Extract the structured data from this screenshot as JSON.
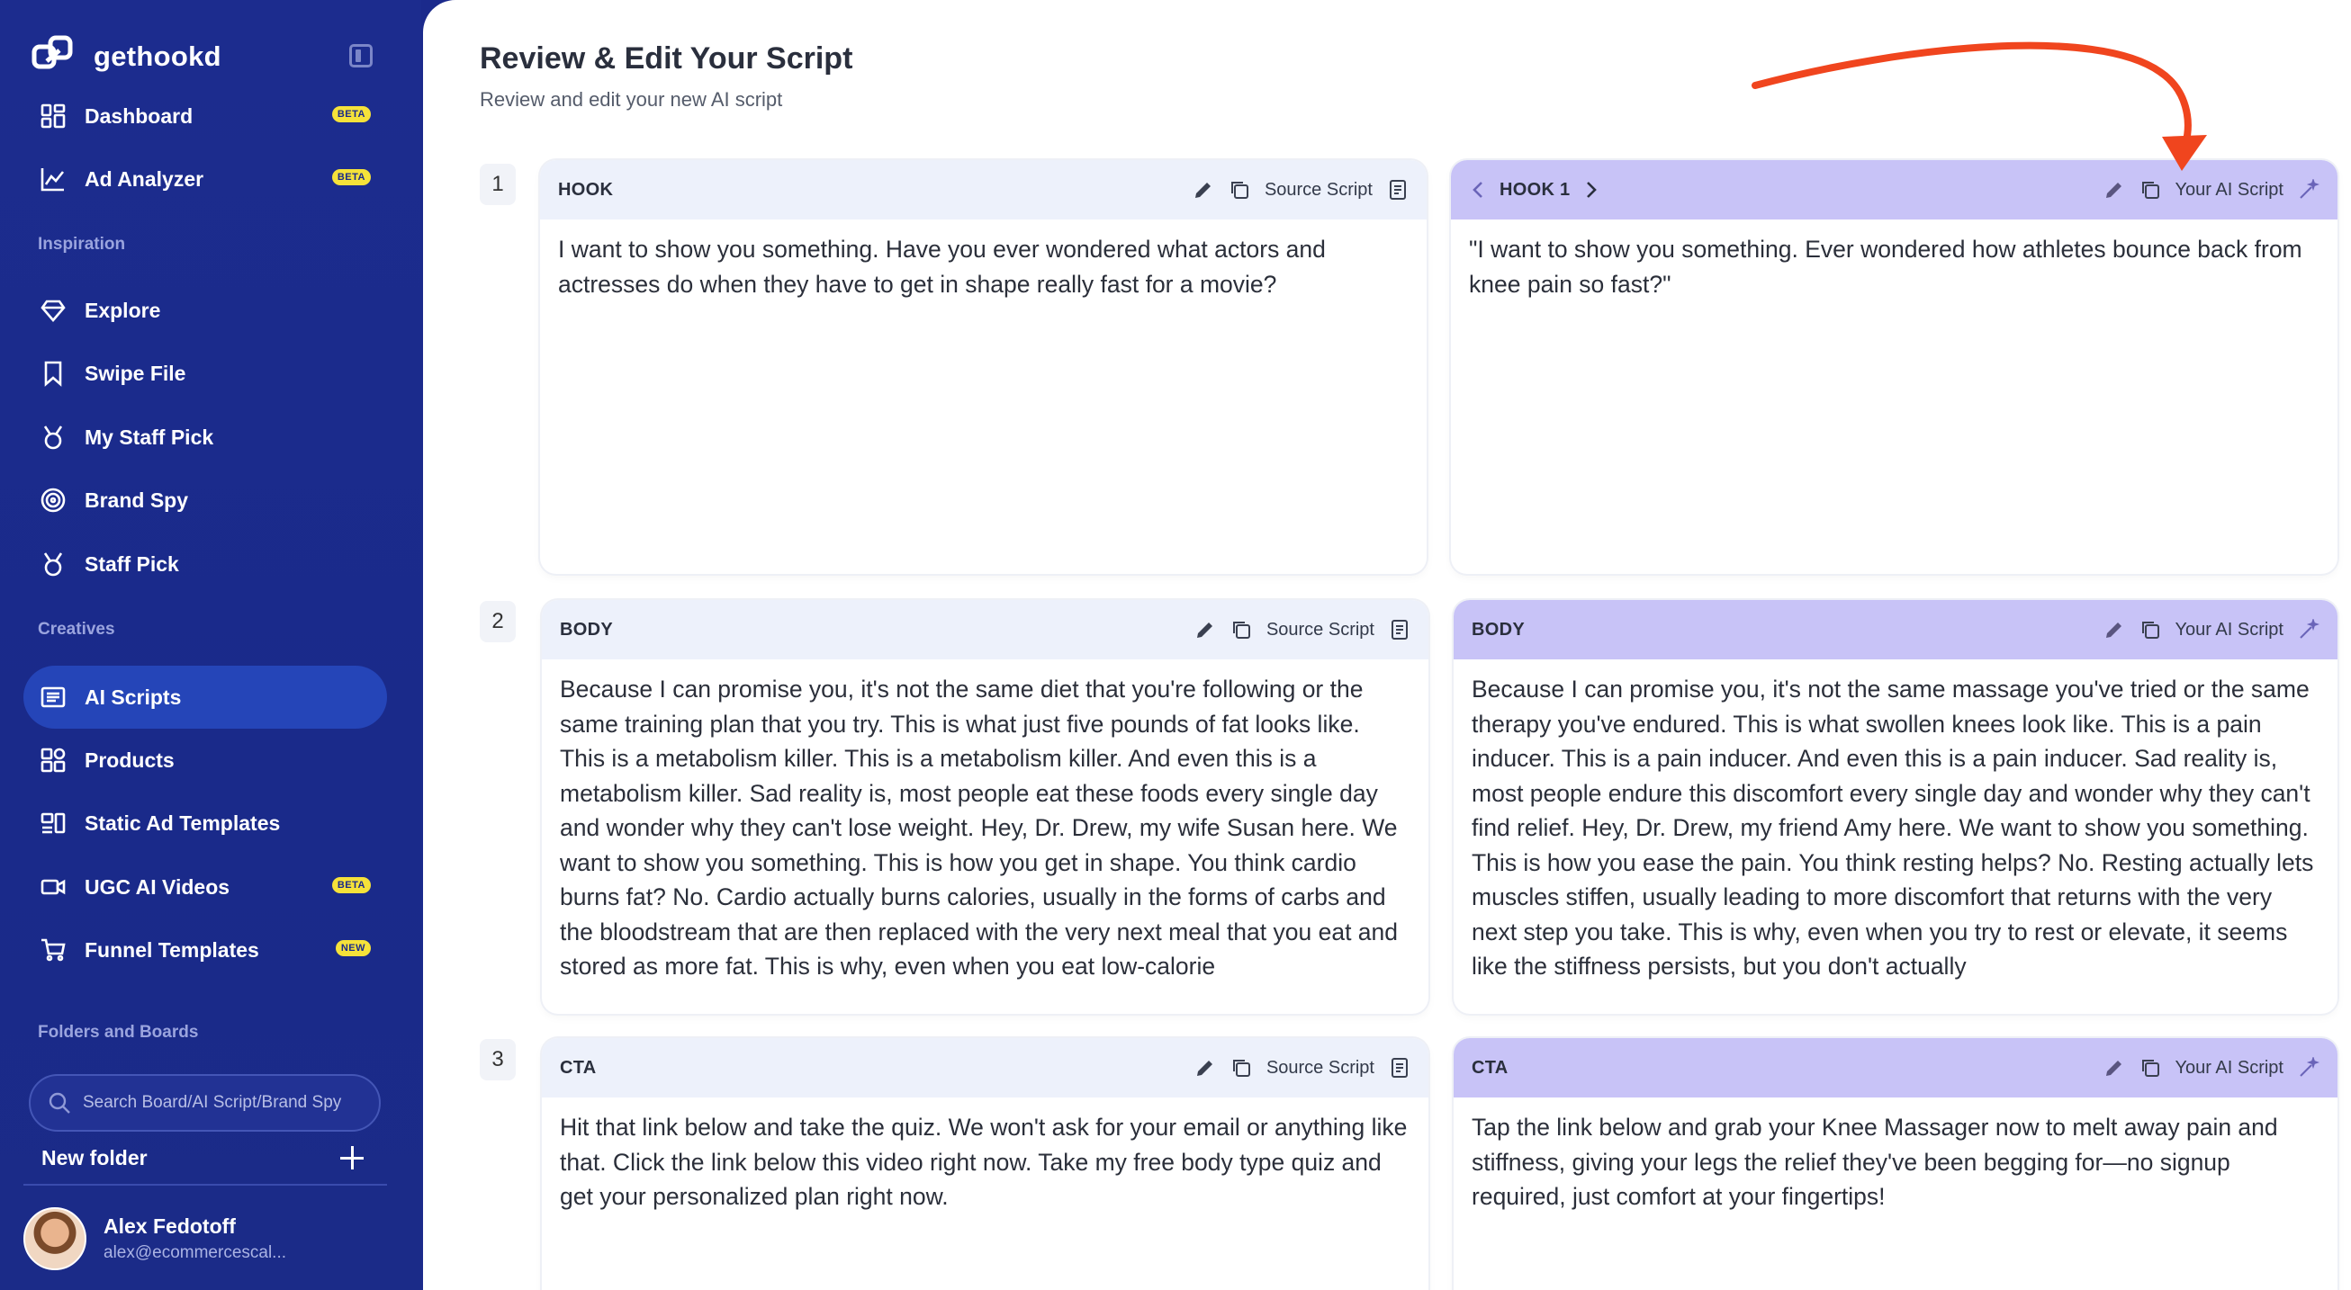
{
  "app": {
    "name": "gethookd"
  },
  "sidebar": {
    "items_top": [
      {
        "label": "Dashboard",
        "badge": "BETA",
        "icon": "dashboard-icon"
      },
      {
        "label": "Ad Analyzer",
        "badge": "BETA",
        "icon": "chart-icon"
      }
    ],
    "inspiration_label": "Inspiration",
    "inspiration_items": [
      {
        "label": "Explore",
        "icon": "diamond-icon"
      },
      {
        "label": "Swipe File",
        "icon": "bookmark-icon"
      },
      {
        "label": "My Staff Pick",
        "icon": "medal-icon"
      },
      {
        "label": "Brand Spy",
        "icon": "target-icon"
      },
      {
        "label": "Staff Pick",
        "icon": "medal-icon"
      }
    ],
    "creatives_label": "Creatives",
    "creatives_items": [
      {
        "label": "AI Scripts",
        "icon": "script-icon",
        "active": true
      },
      {
        "label": "Products",
        "icon": "products-icon"
      },
      {
        "label": "Static Ad Templates",
        "icon": "templates-icon"
      },
      {
        "label": "UGC AI Videos",
        "badge": "BETA",
        "icon": "video-icon"
      },
      {
        "label": "Funnel Templates",
        "badge": "NEW",
        "icon": "cart-icon"
      }
    ],
    "folders_label": "Folders and Boards",
    "search_placeholder": "Search Board/AI Script/Brand Spy",
    "new_folder_label": "New folder",
    "user": {
      "name": "Alex Fedotoff",
      "email": "alex@ecommercescal..."
    }
  },
  "main": {
    "title": "Review & Edit Your Script",
    "subtitle": "Review and edit your new AI script",
    "source_label": "Source Script",
    "ai_label": "Your AI Script",
    "rows": [
      {
        "num": "1",
        "source_head": "HOOK",
        "source_text": "I want to show you something. Have you ever wondered what actors and actresses do when they have to get in shape really fast for a movie?",
        "ai_head": "HOOK 1",
        "ai_text": "\"I want to show you something. Ever wondered how athletes bounce back from knee pain so fast?\""
      },
      {
        "num": "2",
        "source_head": "BODY",
        "source_text": "Because I can promise you, it's not the same diet that you're following or the same training plan that you try. This is what just five pounds of fat looks like. This is a metabolism killer. This is a metabolism killer. And even this is a metabolism killer. Sad reality is, most people eat these foods every single day and wonder why they can't lose weight. Hey, Dr. Drew, my wife Susan here. We want to show you something. This is how you get in shape. You think cardio burns fat? No. Cardio actually burns calories, usually in the forms of carbs and the bloodstream that are then replaced with the very next meal that you eat and stored as more fat. This is why, even when you eat low-calorie",
        "ai_head": "BODY",
        "ai_text": "Because I can promise you, it's not the same massage you've tried or the same therapy you've endured. This is what swollen knees look like. This is a pain inducer. This is a pain inducer. And even this is a pain inducer. Sad reality is, most people endure this discomfort every single day and wonder why they can't find relief. Hey, Dr. Drew, my friend Amy here. We want to show you something. This is how you ease the pain. You think resting helps? No. Resting actually lets muscles stiffen, usually leading to more discomfort that returns with the very next step you take. This is why, even when you try to rest or elevate, it seems like the stiffness persists, but you don't actually"
      },
      {
        "num": "3",
        "source_head": "CTA",
        "source_text": "Hit that link below and take the quiz. We won't ask for your email or anything like that. Click the link below this video right now. Take my free body type quiz and get your personalized plan right now.",
        "ai_head": "CTA",
        "ai_text": "Tap the link below and grab your Knee Massager now to melt away pain and stiffness, giving your legs the relief they've been begging for—no signup required, just comfort at your fingertips!"
      }
    ]
  },
  "colors": {
    "sidebar": "#1c2c8e",
    "active": "#2545b8",
    "ai_header": "#c8c3f7",
    "source_header": "#edf1fb",
    "arrow": "#f0451e"
  }
}
